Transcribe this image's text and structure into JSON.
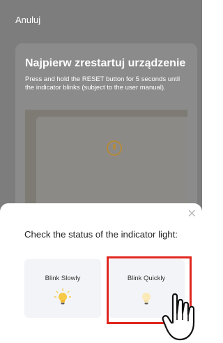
{
  "header": {
    "cancel_label": "Anuluj"
  },
  "card": {
    "title": "Najpierw zrestartuj urządzenie",
    "instructions": "Press and hold the RESET button for 5 seconds until the indicator blinks (subject to the user manual)."
  },
  "dialog": {
    "prompt": "Check the status of the indicator light:",
    "options": [
      {
        "label": "Blink Slowly",
        "icon": "lightbulb-lit-icon"
      },
      {
        "label": "Blink Quickly",
        "icon": "lightbulb-dim-icon"
      }
    ]
  },
  "colors": {
    "highlight": "#e0261e",
    "bulb_on": "#f7c948",
    "bulb_dim": "#fbe9b8"
  }
}
